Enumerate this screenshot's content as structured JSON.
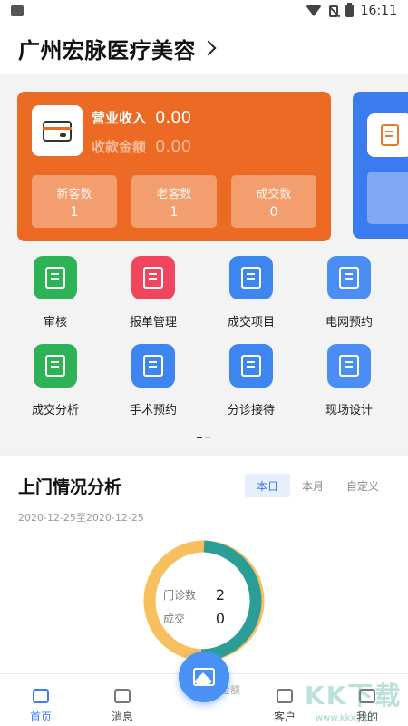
{
  "status_bar": {
    "time": "16:11"
  },
  "header": {
    "title": "广州宏脉医疗美容"
  },
  "revenue_card": {
    "revenue_label": "营业收入",
    "revenue_value": "0.00",
    "collection_label": "收款金额",
    "collection_value": "0.00",
    "accent": "#ec6a23",
    "stats": [
      {
        "label": "新客数",
        "value": "1"
      },
      {
        "label": "老客数",
        "value": "1"
      },
      {
        "label": "成交数",
        "value": "0"
      }
    ]
  },
  "grid": [
    {
      "label": "审核",
      "icon": "stamp-icon",
      "color": "#2db255"
    },
    {
      "label": "报单管理",
      "icon": "clipboard-icon",
      "color": "#f0455c"
    },
    {
      "label": "成交项目",
      "icon": "clipboard-check-icon",
      "color": "#3d86f0"
    },
    {
      "label": "电网预约",
      "icon": "monitor-icon",
      "color": "#4a8ef4"
    },
    {
      "label": "成交分析",
      "icon": "analysis-icon",
      "color": "#2db255"
    },
    {
      "label": "手术预约",
      "icon": "calendar-clock-icon",
      "color": "#3d86f0"
    },
    {
      "label": "分诊接待",
      "icon": "map-icon",
      "color": "#3d86f0"
    },
    {
      "label": "现场设计",
      "icon": "easel-icon",
      "color": "#4a8ef4"
    }
  ],
  "analysis": {
    "title": "上门情况分析",
    "tabs": [
      "本日",
      "本月",
      "自定义"
    ],
    "active_tab": "本日",
    "date_range": "2020-12-25至2020-12-25",
    "visits_label": "门诊数",
    "visits_value": "2",
    "deals_label": "成交",
    "deals_value": "0",
    "ring_colors": [
      "#2a9d96",
      "#f7bf5e"
    ]
  },
  "tabbar": {
    "items": [
      "首页",
      "消息",
      "客户",
      "我的"
    ],
    "active": "首页",
    "fab_partial_label": "金额"
  },
  "watermark": {
    "text": "KK下载",
    "url": "www.kkx.net"
  }
}
